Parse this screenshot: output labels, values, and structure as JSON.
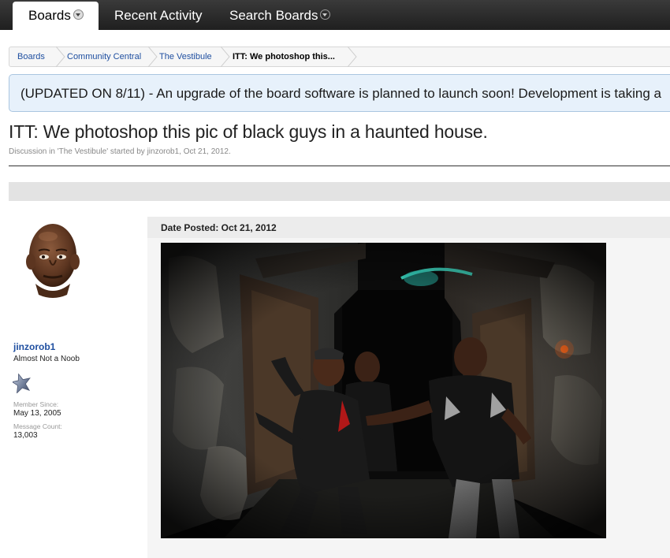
{
  "nav": {
    "tabs": [
      {
        "label": "Boards",
        "selected": true,
        "has_dropdown": true
      },
      {
        "label": "Recent Activity",
        "selected": false,
        "has_dropdown": false
      },
      {
        "label": "Search Boards",
        "selected": false,
        "has_dropdown": true
      }
    ]
  },
  "breadcrumb": [
    "Boards",
    "Community Central",
    "The Vestibule",
    "ITT: We photoshop this..."
  ],
  "notice": {
    "text": "(UPDATED ON 8/11) - An upgrade of the board software is planned to launch soon! Development is taking a"
  },
  "thread": {
    "title": "ITT: We photoshop this pic of black guys in a haunted house.",
    "meta": "Discussion in 'The Vestibule' started by jinzorob1, Oct 21, 2012."
  },
  "post": {
    "author": {
      "username": "jinzorob1",
      "user_title": "Almost Not a Noob",
      "member_since_label": "Member Since:",
      "member_since": "May 13, 2005",
      "message_count_label": "Message Count:",
      "message_count": "13,003",
      "rank_icon": "star-icon",
      "avatar_icon": "avatar"
    },
    "date_posted": "Date Posted: Oct 21, 2012",
    "image_icon": "haunted-house-photo"
  },
  "colors": {
    "nav_bg": "#2a2a2a",
    "link": "#1f4fa0",
    "notice_bg": "#e7f1fb",
    "notice_border": "#aac6e0"
  }
}
